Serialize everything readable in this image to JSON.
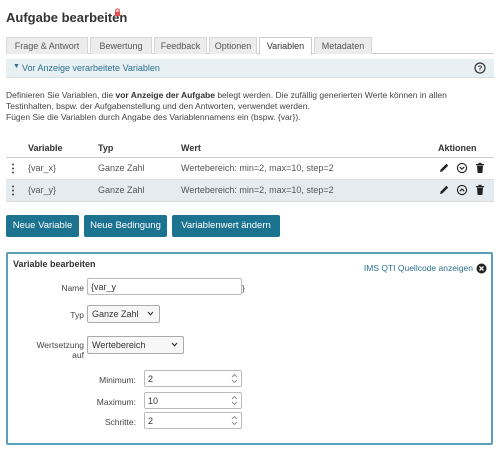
{
  "header": {
    "title": "Aufgabe bearbeiten",
    "lock_icon": "lock-icon",
    "lock_color": "#e05050"
  },
  "tabs": [
    {
      "label": "Frage & Antwort",
      "active": false
    },
    {
      "label": "Bewertung",
      "active": false
    },
    {
      "label": "Feedback",
      "active": false
    },
    {
      "label": "Optionen",
      "active": false
    },
    {
      "label": "Variablen",
      "active": true
    },
    {
      "label": "Metadaten",
      "active": false
    }
  ],
  "accordion": {
    "label": "Vor Anzeige verarbeitete Variablen",
    "icon": "chevron-down-icon",
    "help_icon": "help-icon"
  },
  "description": {
    "p1_a": "Definieren Sie Variablen, die ",
    "p1_b": "vor Anzeige der Aufgabe",
    "p1_c": " belegt werden. Die zufällig generierten Werte können in allen Testinhalten, bspw. der Aufgabenstellung und den Antworten, verwendet werden.",
    "p2": "Fügen Sie die Variablen durch Angabe des Variablennamens ein (bspw. {var})."
  },
  "table": {
    "headers": {
      "variable": "Variable",
      "typ": "Typ",
      "wert": "Wert",
      "aktionen": "Aktionen"
    },
    "rows": [
      {
        "variable": "{var_x}",
        "typ": "Ganze Zahl",
        "wert": "Wertebereich: min=2, max=10, step=2",
        "selected": false,
        "toggle_icon": "chevron-down-circle-icon"
      },
      {
        "variable": "{var_y}",
        "typ": "Ganze Zahl",
        "wert": "Wertebereich: min=2, max=10, step=2",
        "selected": true,
        "toggle_icon": "chevron-up-circle-icon"
      }
    ]
  },
  "buttons": {
    "new_variable": "Neue Variable",
    "new_condition": "Neue Bedingung",
    "change_value": "Variablenwert ändern"
  },
  "editor": {
    "title": "Variable bearbeiten",
    "qti_link": "IMS QTI Quellcode anzeigen",
    "name_label": "Name",
    "name_value": "{var_y",
    "name_suffix": "}",
    "typ_label": "Typ",
    "typ_value": "Ganze Zahl",
    "setting_label_1": "Wertsetzung",
    "setting_label_2": "auf",
    "setting_value": "Wertebereich",
    "min_label": "Minimum:",
    "min_value": "2",
    "max_label": "Maximum:",
    "max_value": "10",
    "step_label": "Schritte:",
    "step_value": "2"
  },
  "colors": {
    "accent": "#1c7390",
    "link": "#2c6f8f",
    "selected_row": "#e4ebf1",
    "border_box": "#5aa0b8"
  }
}
